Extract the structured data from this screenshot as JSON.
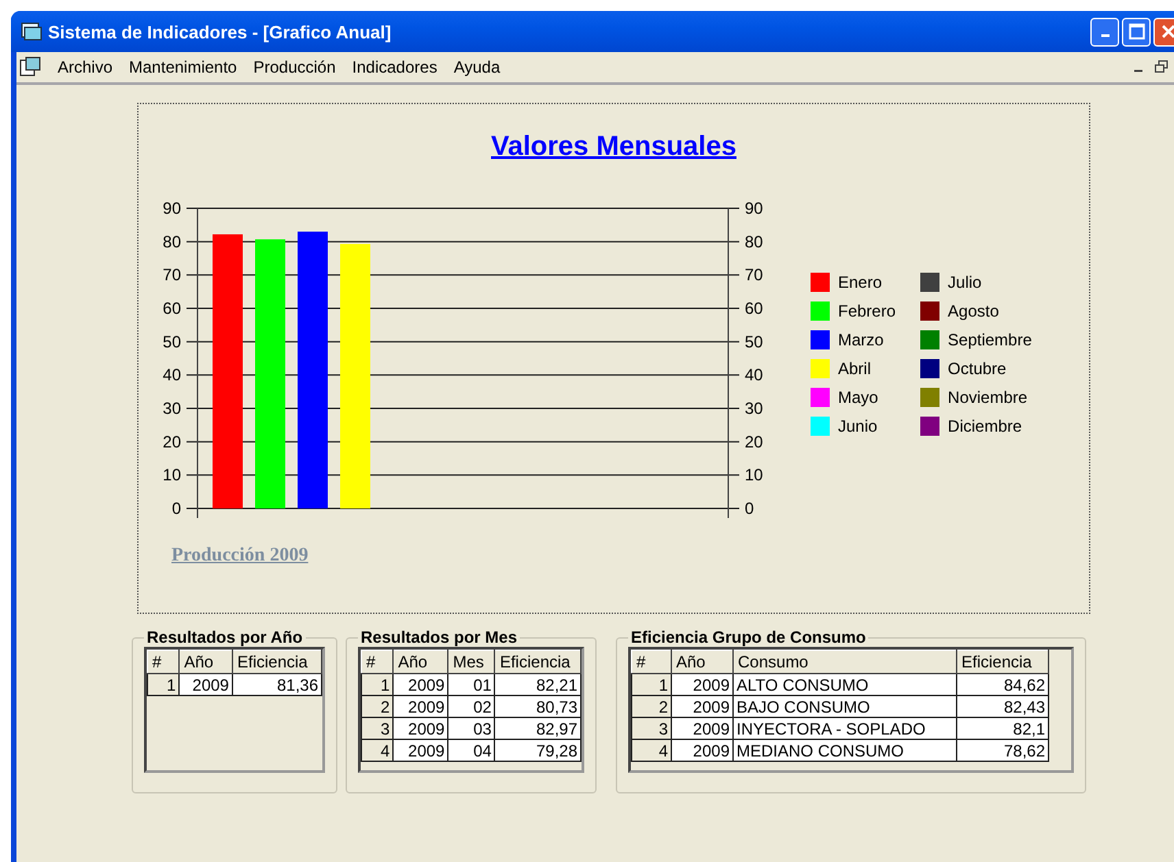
{
  "window": {
    "title": "Sistema de Indicadores - [Grafico Anual]"
  },
  "menu": [
    "Archivo",
    "Mantenimiento",
    "Producción",
    "Indicadores",
    "Ayuda"
  ],
  "chart": {
    "footer": "Producción 2009",
    "chart_data": {
      "type": "bar",
      "title": "Valores Mensuales",
      "ylim": [
        0,
        90
      ],
      "yticks": [
        0,
        10,
        20,
        30,
        40,
        50,
        60,
        70,
        80,
        90
      ],
      "y2ticks": [
        0,
        10,
        20,
        30,
        40,
        50,
        60,
        70,
        80,
        90
      ],
      "y2lim": [
        0,
        90
      ],
      "grid": true,
      "series": [
        {
          "name": "Enero",
          "color": "#ff0000",
          "values": [
            82.2
          ]
        },
        {
          "name": "Febrero",
          "color": "#00ff00",
          "values": [
            80.7
          ]
        },
        {
          "name": "Marzo",
          "color": "#0000ff",
          "values": [
            83.0
          ]
        },
        {
          "name": "Abril",
          "color": "#ffff00",
          "values": [
            79.3
          ]
        },
        {
          "name": "Mayo",
          "color": "#ff00ff",
          "values": [
            null
          ]
        },
        {
          "name": "Junio",
          "color": "#00ffff",
          "values": [
            null
          ]
        },
        {
          "name": "Julio",
          "color": "#404040",
          "values": [
            null
          ]
        },
        {
          "name": "Agosto",
          "color": "#800000",
          "values": [
            null
          ]
        },
        {
          "name": "Septiembre",
          "color": "#008000",
          "values": [
            null
          ]
        },
        {
          "name": "Octubre",
          "color": "#000080",
          "values": [
            null
          ]
        },
        {
          "name": "Noviembre",
          "color": "#808000",
          "values": [
            null
          ]
        },
        {
          "name": "Diciembre",
          "color": "#800080",
          "values": [
            null
          ]
        }
      ]
    }
  },
  "groups": [
    {
      "title": "Resultados por Año",
      "columns": [
        "#",
        "Año",
        "Eficiencia"
      ],
      "rows": [
        [
          "1",
          "2009",
          "81,36"
        ]
      ]
    },
    {
      "title": "Resultados por Mes",
      "columns": [
        "#",
        "Año",
        "Mes",
        "Eficiencia"
      ],
      "rows": [
        [
          "1",
          "2009",
          "01",
          "82,21"
        ],
        [
          "2",
          "2009",
          "02",
          "80,73"
        ],
        [
          "3",
          "2009",
          "03",
          "82,97"
        ],
        [
          "4",
          "2009",
          "04",
          "79,28"
        ]
      ]
    },
    {
      "title": "Eficiencia Grupo de Consumo",
      "columns": [
        "#",
        "Año",
        "Consumo",
        "Eficiencia"
      ],
      "rows": [
        [
          "1",
          "2009",
          "ALTO CONSUMO",
          "84,62"
        ],
        [
          "2",
          "2009",
          "BAJO CONSUMO",
          "82,43"
        ],
        [
          "3",
          "2009",
          "INYECTORA - SOPLADO",
          "82,1"
        ],
        [
          "4",
          "2009",
          "MEDIANO CONSUMO",
          "78,62"
        ]
      ]
    }
  ]
}
